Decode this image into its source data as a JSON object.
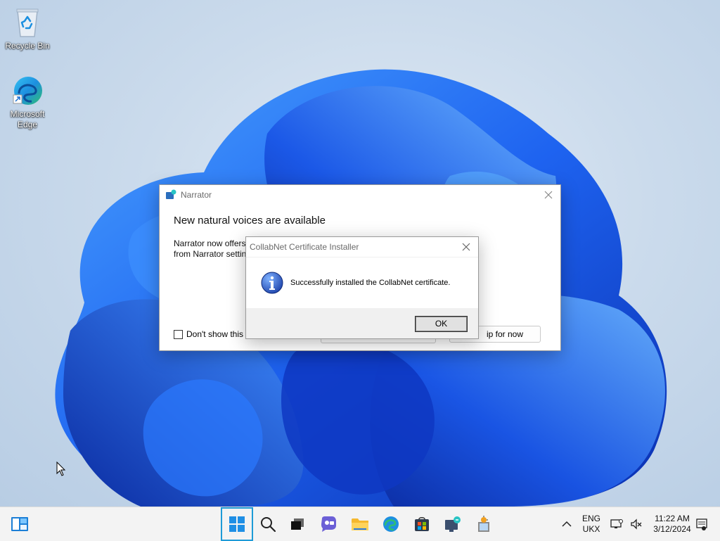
{
  "desktop": {
    "icons": [
      {
        "label": "Recycle Bin",
        "icon": "recycle-bin-icon"
      },
      {
        "label": "Microsoft Edge",
        "icon": "edge-icon"
      }
    ]
  },
  "narrator_window": {
    "title": "Narrator",
    "heading": "New natural voices are available",
    "body": "Narrator now offers from Narrator settin",
    "checkbox_label": "Don't show this a",
    "skip_button": "ip for now"
  },
  "installer_dialog": {
    "title": "CollabNet Certificate Installer",
    "message": "Successfully installed the CollabNet certificate.",
    "ok_button": "OK",
    "icon": "info-icon"
  },
  "taskbar": {
    "apps": [
      "widgets-icon",
      "start-icon",
      "search-icon",
      "task-view-icon",
      "chat-icon",
      "file-explorer-icon",
      "edge-icon",
      "store-icon",
      "narrator-icon",
      "installer-icon"
    ],
    "tray": {
      "lang_line1": "ENG",
      "lang_line2": "UKX",
      "time": "11:22 AM",
      "date": "3/12/2024"
    }
  },
  "colors": {
    "accent": "#1e9bd7",
    "wallpaper_blue": "#1a5fe8"
  }
}
